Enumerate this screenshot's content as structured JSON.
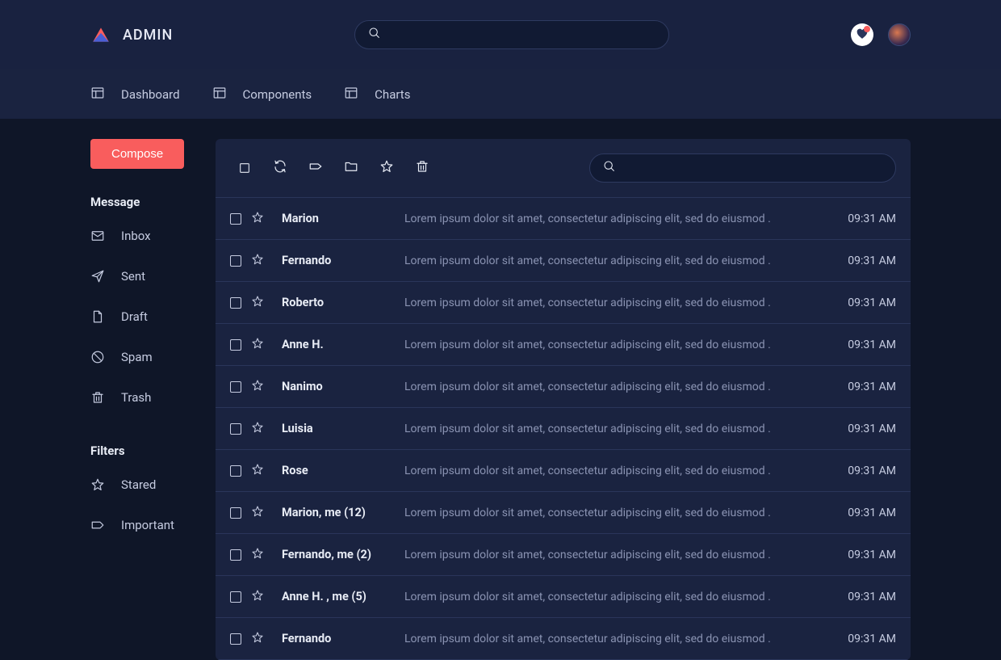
{
  "brand": "ADMIN",
  "header": {
    "search_placeholder": ""
  },
  "nav": [
    {
      "label": "Dashboard",
      "icon": "panel-icon"
    },
    {
      "label": "Components",
      "icon": "panel-icon"
    },
    {
      "label": "Charts",
      "icon": "panel-icon"
    }
  ],
  "compose_label": "Compose",
  "sidebar": {
    "section_message": "Message",
    "section_filters": "Filters",
    "message_items": [
      {
        "id": "inbox",
        "label": "Inbox",
        "icon": "envelope-icon"
      },
      {
        "id": "sent",
        "label": "Sent",
        "icon": "paper-plane-icon"
      },
      {
        "id": "draft",
        "label": "Draft",
        "icon": "file-icon"
      },
      {
        "id": "spam",
        "label": "Spam",
        "icon": "ban-icon"
      },
      {
        "id": "trash",
        "label": "Trash",
        "icon": "trash-icon"
      }
    ],
    "filter_items": [
      {
        "id": "stared",
        "label": "Stared",
        "icon": "star-icon"
      },
      {
        "id": "important",
        "label": "Important",
        "icon": "label-icon"
      }
    ]
  },
  "toolbar": {
    "search_placeholder": ""
  },
  "messages": [
    {
      "sender": "Marion",
      "preview": "Lorem ipsum dolor sit amet, consectetur adipiscing elit, sed do eiusmod  .",
      "time": "09:31 AM"
    },
    {
      "sender": "Fernando",
      "preview": "Lorem ipsum dolor sit amet, consectetur adipiscing elit, sed do eiusmod  .",
      "time": "09:31 AM"
    },
    {
      "sender": "Roberto",
      "preview": "Lorem ipsum dolor sit amet, consectetur adipiscing elit, sed do eiusmod  .",
      "time": "09:31 AM"
    },
    {
      "sender": "Anne H.",
      "preview": "Lorem ipsum dolor sit amet, consectetur adipiscing elit, sed do eiusmod  .",
      "time": "09:31 AM"
    },
    {
      "sender": "Nanimo",
      "preview": "Lorem ipsum dolor sit amet, consectetur adipiscing elit, sed do eiusmod  .",
      "time": "09:31 AM"
    },
    {
      "sender": "Luisia",
      "preview": "Lorem ipsum dolor sit amet, consectetur adipiscing elit, sed do eiusmod  .",
      "time": "09:31 AM"
    },
    {
      "sender": "Rose",
      "preview": "Lorem ipsum dolor sit amet, consectetur adipiscing elit, sed do eiusmod  .",
      "time": "09:31 AM"
    },
    {
      "sender": "Marion, me (12)",
      "preview": "Lorem ipsum dolor sit amet, consectetur adipiscing elit, sed do eiusmod  .",
      "time": "09:31 AM"
    },
    {
      "sender": "Fernando, me (2)",
      "preview": "Lorem ipsum dolor sit amet, consectetur adipiscing elit, sed do eiusmod  .",
      "time": "09:31 AM"
    },
    {
      "sender": "Anne H. , me (5)",
      "preview": "Lorem ipsum dolor sit amet, consectetur adipiscing elit, sed do eiusmod  .",
      "time": "09:31 AM"
    },
    {
      "sender": "Fernando",
      "preview": "Lorem ipsum dolor sit amet, consectetur adipiscing elit, sed do eiusmod  .",
      "time": "09:31 AM"
    }
  ]
}
